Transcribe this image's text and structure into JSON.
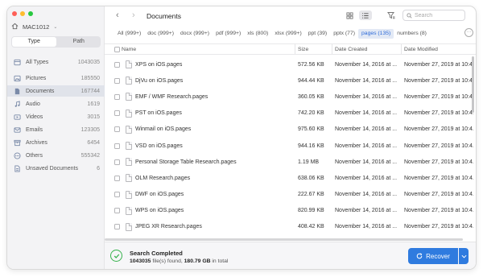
{
  "sidebar": {
    "device": "MAC1012",
    "segments": [
      "Type",
      "Path"
    ],
    "categories": [
      {
        "label": "All Types",
        "count": "1043035",
        "icon": "all-types-icon"
      },
      {
        "label": "Pictures",
        "count": "185550",
        "icon": "picture-icon"
      },
      {
        "label": "Documents",
        "count": "167744",
        "icon": "document-icon"
      },
      {
        "label": "Audio",
        "count": "1619",
        "icon": "audio-icon"
      },
      {
        "label": "Videos",
        "count": "3015",
        "icon": "video-icon"
      },
      {
        "label": "Emails",
        "count": "123305",
        "icon": "email-icon"
      },
      {
        "label": "Archives",
        "count": "6454",
        "icon": "archive-icon"
      },
      {
        "label": "Others",
        "count": "555342",
        "icon": "others-icon"
      },
      {
        "label": "Unsaved Documents",
        "count": "6",
        "icon": "unsaved-document-icon"
      }
    ]
  },
  "toolbar": {
    "title": "Documents",
    "search_placeholder": "Search"
  },
  "filters": [
    "All (999+)",
    "doc (999+)",
    "docx (999+)",
    "pdf (999+)",
    "xls (800)",
    "xlsx (999+)",
    "ppt (39)",
    "pptx (77)",
    "pages (135)",
    "numbers (8)"
  ],
  "table": {
    "headers": {
      "name": "Name",
      "size": "Size",
      "created": "Date Created",
      "modified": "Date Modified"
    },
    "rows": [
      {
        "name": "XPS on iOS.pages",
        "size": "572.56 KB",
        "created": "November 14, 2016 at ...",
        "modified": "November 27, 2019 at 10:4..."
      },
      {
        "name": "DjVu on iOS.pages",
        "size": "944.44 KB",
        "created": "November 14, 2016 at ...",
        "modified": "November 27, 2019 at 10:4..."
      },
      {
        "name": "EMF / WMF Research.pages",
        "size": "360.05 KB",
        "created": "November 14, 2016 at ...",
        "modified": "November 27, 2019 at 10:4..."
      },
      {
        "name": "PST on iOS.pages",
        "size": "742.20 KB",
        "created": "November 14, 2016 at ...",
        "modified": "November 27, 2019 at 10:4..."
      },
      {
        "name": "Winmail on iOS.pages",
        "size": "975.60 KB",
        "created": "November 14, 2016 at ...",
        "modified": "November 27, 2019 at 10:4..."
      },
      {
        "name": "VSD on iOS.pages",
        "size": "944.16 KB",
        "created": "November 14, 2016 at ...",
        "modified": "November 27, 2019 at 10:4..."
      },
      {
        "name": "Personal Storage Table Research.pages",
        "size": "1.19 MB",
        "created": "November 14, 2016 at ...",
        "modified": "November 27, 2019 at 10:4..."
      },
      {
        "name": "OLM Research.pages",
        "size": "638.06 KB",
        "created": "November 14, 2016 at ...",
        "modified": "November 27, 2019 at 10:4..."
      },
      {
        "name": "DWF on iOS.pages",
        "size": "222.67 KB",
        "created": "November 14, 2016 at ...",
        "modified": "November 27, 2019 at 10:4..."
      },
      {
        "name": "WPS on iOS.pages",
        "size": "820.99 KB",
        "created": "November 14, 2016 at ...",
        "modified": "November 27, 2019 at 10:4..."
      },
      {
        "name": "JPEG XR Research.pages",
        "size": "408.42 KB",
        "created": "November 14, 2016 at ...",
        "modified": "November 27, 2019 at 10:4..."
      }
    ]
  },
  "footer": {
    "status": "Search Completed",
    "count": "1043035",
    "files_text": "file(s) found,",
    "size": "180.79 GB",
    "size_suffix": "in total",
    "recover_label": "Recover"
  },
  "colors": {
    "accent": "#2f7bdf",
    "success": "#37b24d",
    "filter_active": "#2e6bd8"
  }
}
